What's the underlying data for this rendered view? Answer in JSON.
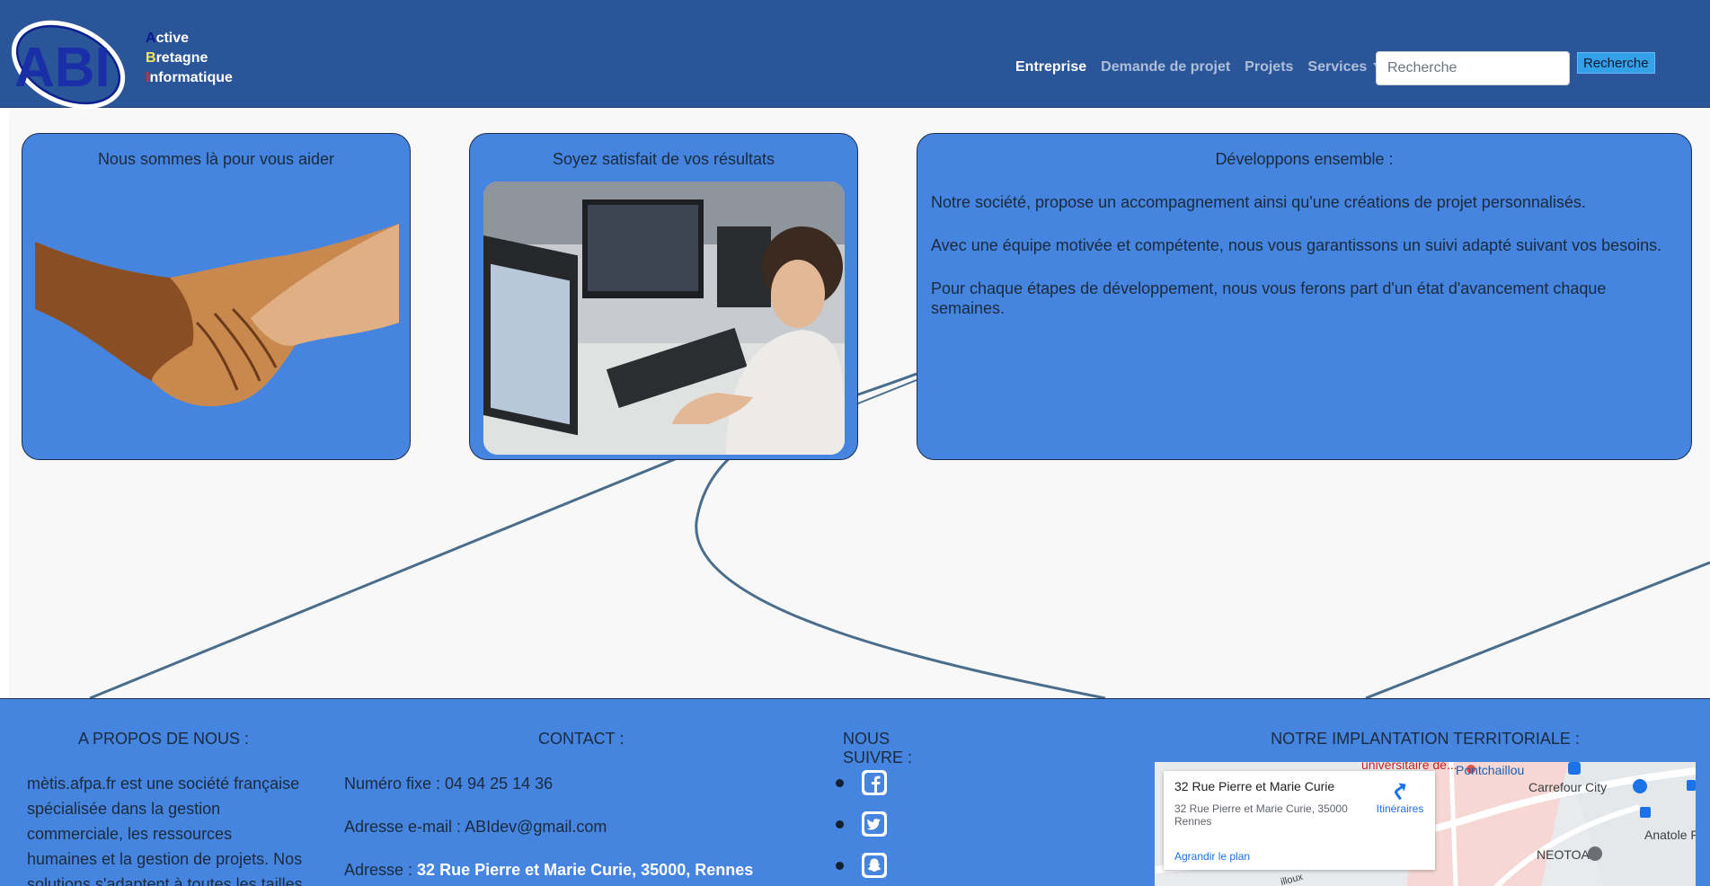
{
  "brand": {
    "logo_letters": "ABI",
    "lines": [
      {
        "initial": "A",
        "rest": "ctive"
      },
      {
        "initial": "B",
        "rest": "retagne"
      },
      {
        "initial": "I",
        "rest": "nformatique"
      }
    ]
  },
  "nav": {
    "items": [
      {
        "label": "Entreprise",
        "active": true
      },
      {
        "label": "Demande de projet",
        "active": false
      },
      {
        "label": "Projets",
        "active": false
      },
      {
        "label": "Services",
        "active": false,
        "dropdown": true
      }
    ],
    "search_placeholder": "Recherche",
    "search_button": "Recherche"
  },
  "cards": [
    {
      "title": "Nous sommes là pour vous aider"
    },
    {
      "title": "Soyez satisfait de vos résultats"
    },
    {
      "title": "Développons ensemble :",
      "paragraphs": [
        "Notre société, propose un accompagnement ainsi qu'une créations de projet personnalisés.",
        "Avec une équipe motivée et compétente, nous vous garantissons un suivi adapté suivant vos besoins.",
        "Pour chaque étapes de développement, nous vous ferons part d'un état d'avancement chaque semaines."
      ]
    }
  ],
  "footer": {
    "about": {
      "heading": "A PROPOS DE NOUS :",
      "text": "mètis.afpa.fr est une société française spécialisée dans la gestion commerciale, les ressources humaines et la gestion de projets. Nos solutions s'adaptent à toutes les tailles"
    },
    "contact": {
      "heading": "CONTACT :",
      "phone_label": "Numéro fixe : ",
      "phone": "04 94 25 14 36",
      "email_label": "Adresse e-mail : ",
      "email": "ABIdev@gmail.com",
      "address_label": "Adresse : ",
      "address": "32 Rue Pierre et Marie Curie, 35000, Rennes"
    },
    "follow": {
      "heading": "NOUS SUIVRE :",
      "networks": [
        "facebook-icon",
        "twitter-icon",
        "snapchat-icon"
      ]
    },
    "location": {
      "heading": "NOTRE IMPLANTATION TERRITORIALE :",
      "map_title": "32 Rue Pierre et Marie Curie",
      "map_address": "32 Rue Pierre et Marie Curie, 35000 Rennes",
      "map_directions": "Itinéraires",
      "map_enlarge": "Agrandir le plan",
      "map_labels": [
        "universitaire de...",
        "Pontchaillou",
        "Carrefour City",
        "NEOTOA",
        "Anatole F",
        "illoux"
      ]
    }
  },
  "colors": {
    "navbar": "#2a5599",
    "card": "#4585e0",
    "footer": "#4585e0",
    "search_button": "#34a0e8"
  }
}
